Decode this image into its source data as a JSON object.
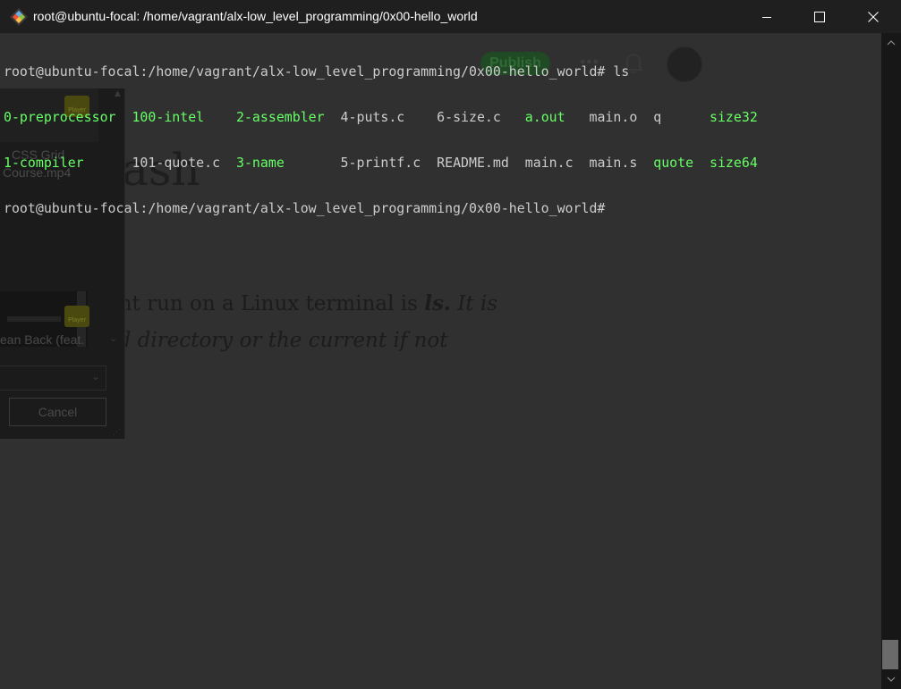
{
  "window": {
    "title": "root@ubuntu-focal: /home/vagrant/alx-low_level_programming/0x00-hello_world",
    "app_icon": "git-bash-diamond-icon",
    "controls": [
      "minimize-icon",
      "maximize-icon",
      "close-icon"
    ]
  },
  "terminal": {
    "prompt": "root@ubuntu-focal:/home/vagrant/alx-low_level_programming/0x00-hello_world#",
    "command": " ls",
    "ls_rows": [
      [
        {
          "name": "0-preprocessor",
          "type": "dir"
        },
        {
          "name": "100-intel",
          "type": "dir"
        },
        {
          "name": "2-assembler",
          "type": "dir"
        },
        {
          "name": "4-puts.c",
          "type": "file"
        },
        {
          "name": "6-size.c",
          "type": "file"
        },
        {
          "name": "a.out",
          "type": "exe"
        },
        {
          "name": "main.o",
          "type": "file"
        },
        {
          "name": "q",
          "type": "file"
        },
        {
          "name": "size32",
          "type": "exe"
        }
      ],
      [
        {
          "name": "1-compiler",
          "type": "dir"
        },
        {
          "name": "101-quote.c",
          "type": "file"
        },
        {
          "name": "3-name",
          "type": "dir"
        },
        {
          "name": "5-printf.c",
          "type": "file"
        },
        {
          "name": "README.md",
          "type": "file"
        },
        {
          "name": "main.c",
          "type": "file"
        },
        {
          "name": "main.s",
          "type": "file"
        },
        {
          "name": "quote",
          "type": "exe"
        },
        {
          "name": "size64",
          "type": "exe"
        }
      ]
    ],
    "final_prompt": "root@ubuntu-focal:/home/vagrant/alx-low_level_programming/0x00-hello_world#",
    "colors": {
      "background": "#303030",
      "text": "#cccccc",
      "dir": "#66ff66",
      "exe": "#66ff66"
    }
  },
  "background_ghost": {
    "publish_label": "Publish",
    "heading_fragment": "bash",
    "para_line1_plain": "ght run on a Linux terminal is ",
    "para_line1_bold": "ls.",
    "para_line1_italic": " It is",
    "para_line2": "ed directory or the current if not",
    "panel": {
      "item1_caption_line1": "CSS Grid",
      "item1_caption_line2": "Course.mp4",
      "item2_caption": "ean Back (feat.",
      "badge_label": "Player",
      "cancel_label": "Cancel"
    }
  }
}
